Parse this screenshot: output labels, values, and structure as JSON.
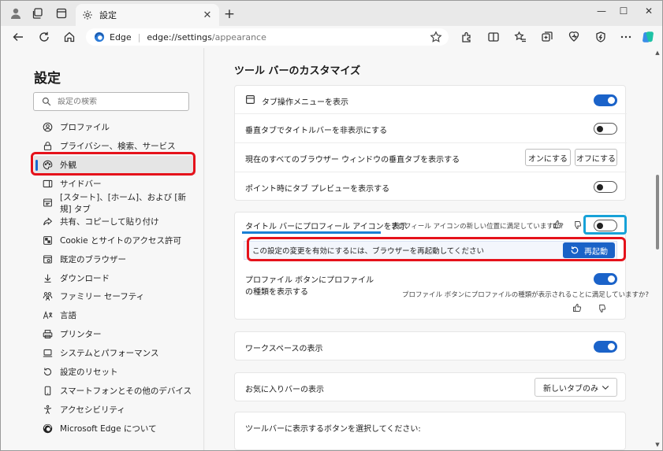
{
  "window": {
    "tab_title": "設定",
    "minimize_label": "—",
    "maximize_label": "☐",
    "close_label": "✕"
  },
  "toolbar": {
    "brand": "Edge",
    "url_host": "edge://settings",
    "url_path": "/appearance"
  },
  "sidebar": {
    "title": "設定",
    "search_placeholder": "設定の検索",
    "items": [
      {
        "label": "プロファイル",
        "icon": "profile-icon"
      },
      {
        "label": "プライバシー、検索、サービス",
        "icon": "lock-icon"
      },
      {
        "label": "外観",
        "icon": "appearance-icon",
        "active": true
      },
      {
        "label": "サイドバー",
        "icon": "sidebar-icon"
      },
      {
        "label": "[スタート]、[ホーム]、および [新規] タブ",
        "icon": "home-tab-icon"
      },
      {
        "label": "共有、コピーして貼り付け",
        "icon": "share-icon"
      },
      {
        "label": "Cookie とサイトのアクセス許可",
        "icon": "cookie-icon"
      },
      {
        "label": "既定のブラウザー",
        "icon": "browser-icon"
      },
      {
        "label": "ダウンロード",
        "icon": "download-icon"
      },
      {
        "label": "ファミリー セーフティ",
        "icon": "family-icon"
      },
      {
        "label": "言語",
        "icon": "language-icon"
      },
      {
        "label": "プリンター",
        "icon": "printer-icon"
      },
      {
        "label": "システムとパフォーマンス",
        "icon": "laptop-icon"
      },
      {
        "label": "設定のリセット",
        "icon": "reset-icon"
      },
      {
        "label": "スマートフォンとその他のデバイス",
        "icon": "phone-icon"
      },
      {
        "label": "アクセシビリティ",
        "icon": "accessibility-icon"
      },
      {
        "label": "Microsoft Edge について",
        "icon": "edge-logo-icon"
      }
    ]
  },
  "main": {
    "section_title": "ツール バーのカスタマイズ",
    "card1": {
      "tab_actions_menu": {
        "label": "タブ操作メニューを表示",
        "on": true
      },
      "hide_titlebar_vertical": {
        "label": "垂直タブでタイトルバーを非表示にする",
        "on": false
      },
      "show_vertical_all": {
        "label": "現在のすべてのブラウザー ウィンドウの垂直タブを表示する",
        "on_button": "オンにする",
        "off_button": "オフにする"
      },
      "tab_preview": {
        "label": "ポイント時にタブ プレビューを表示する",
        "on": false
      }
    },
    "card2": {
      "profile_icon_titlebar": {
        "label": "タイトル バーにプロフィール アイコンを表示",
        "feedback": "プロフィール アイコンの新しい位置に満足していますか?",
        "on": false
      },
      "restart_banner": {
        "text": "この設定の変更を有効にするには、ブラウザーを再起動してください",
        "button": "再起動"
      },
      "profile_type": {
        "label_line1": "プロファイル ボタンにプロファイル",
        "label_line2": "の種類を表示する",
        "feedback": "プロファイル ボタンにプロファイルの種類が表示されることに満足していますか?",
        "on": true
      }
    },
    "workspaces": {
      "label": "ワークスペースの表示",
      "on": true
    },
    "favorites_bar": {
      "label": "お気に入りバーの表示",
      "selected": "新しいタブのみ"
    },
    "toolbar_buttons": {
      "label": "ツールバーに表示するボタンを選択してください:"
    }
  },
  "colors": {
    "accent": "#1b63c9",
    "highlight_red": "#e5121b",
    "highlight_blue": "#17a2d8"
  }
}
